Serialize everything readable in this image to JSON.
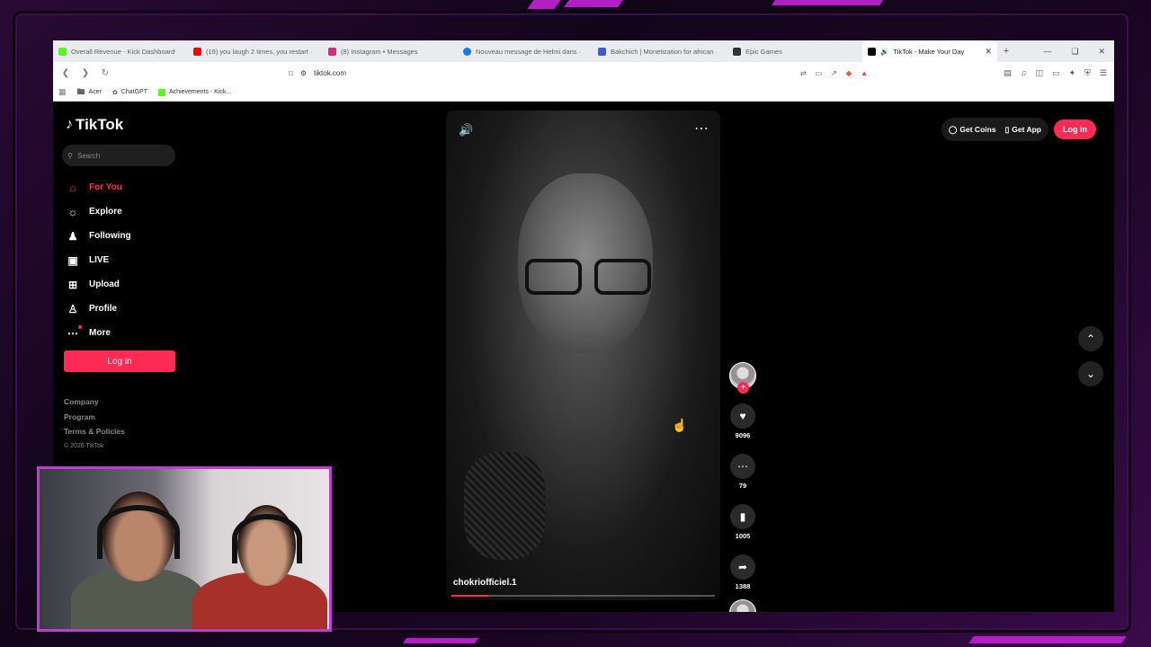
{
  "tabs": [
    {
      "title": "Overall Revenue - Kick Dashboard",
      "favicon": "kick-icon",
      "color": "#53fc18",
      "active": false
    },
    {
      "title": "(19) you laugh 2 times, you restart ·",
      "favicon": "youtube-icon",
      "color": "#ff0000",
      "active": false
    },
    {
      "title": "(8) Instagram • Messages",
      "favicon": "instagram-icon",
      "color": "#d62976",
      "active": false
    },
    {
      "title": "Nouveau message de Helmi dans ·",
      "favicon": "facebook-icon",
      "color": "#1877f2",
      "active": false
    },
    {
      "title": "Bakchich | Monetization for african ·",
      "favicon": "bakchich-icon",
      "color": "#3b5bdb",
      "active": false
    },
    {
      "title": "Epic Games",
      "favicon": "epic-icon",
      "color": "#333333",
      "active": false
    },
    {
      "title": "TikTok - Make Your Day",
      "favicon": "tiktok-icon",
      "color": "#000000",
      "active": true
    }
  ],
  "address_bar": {
    "url": "tiktok.com"
  },
  "bookmarks": [
    {
      "label": "Acer",
      "icon": "folder-icon"
    },
    {
      "label": "ChatGPT",
      "icon": "chatgpt-icon"
    },
    {
      "label": "Achievements - Kick...",
      "icon": "kick-icon"
    }
  ],
  "tiktok": {
    "logo": "TikTok",
    "search_placeholder": "Search",
    "nav": [
      {
        "label": "For You",
        "icon": "home-icon",
        "active": true
      },
      {
        "label": "Explore",
        "icon": "compass-icon",
        "active": false
      },
      {
        "label": "Following",
        "icon": "following-icon",
        "active": false
      },
      {
        "label": "LIVE",
        "icon": "live-icon",
        "active": false
      },
      {
        "label": "Upload",
        "icon": "upload-icon",
        "active": false
      },
      {
        "label": "Profile",
        "icon": "profile-icon",
        "active": false
      },
      {
        "label": "More",
        "icon": "more-icon",
        "active": false
      }
    ],
    "login_label": "Log in",
    "footer": {
      "company": "Company",
      "program": "Program",
      "terms": "Terms & Policies",
      "copyright": "© 2026 TikTok"
    },
    "top_right": {
      "get_coins": "Get Coins",
      "get_app": "Get App",
      "login": "Log in"
    },
    "video": {
      "username": "chokriofficiel.1",
      "progress": 0.14
    },
    "actions": {
      "likes": "9096",
      "comments": "79",
      "saves": "1005",
      "shares": "1388"
    }
  },
  "colors": {
    "brand": "#fe2c55",
    "overlay_accent": "#c23bd4"
  }
}
